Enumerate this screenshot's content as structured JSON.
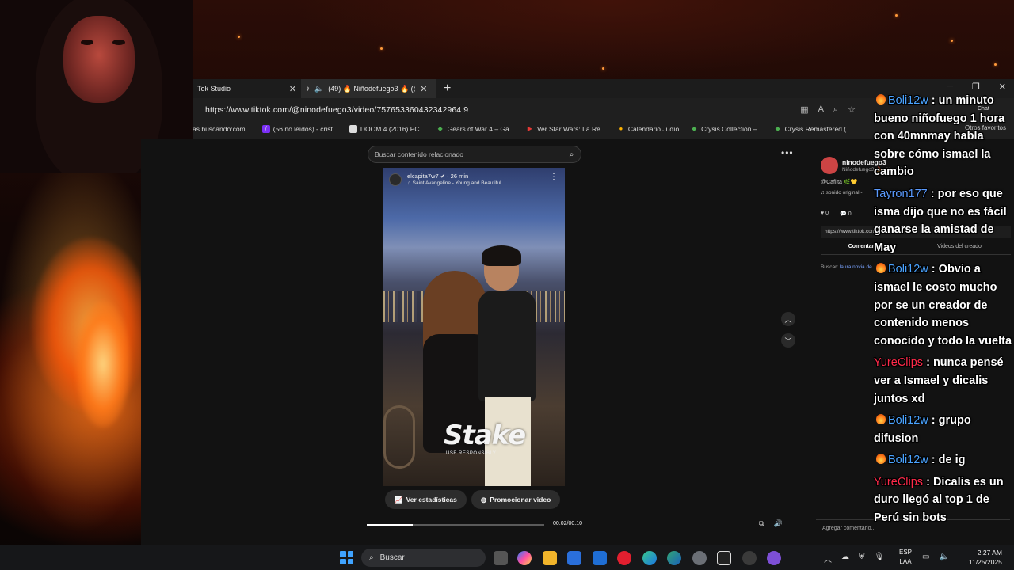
{
  "browser": {
    "tabs": [
      {
        "label": "Tok Studio"
      },
      {
        "label": "(49) 🔥 Niñodefuego3 🔥 (@"
      }
    ],
    "url": "https://www.tiktok.com/@ninodefuego3/video/757653360432342964 9",
    "bookmarks": [
      {
        "label": "as buscando:com...",
        "icon": "page-icon"
      },
      {
        "label": "(56 no leídos) - crist...",
        "icon": "yahoo-icon"
      },
      {
        "label": "DOOM 4 (2016) PC...",
        "icon": "page-icon"
      },
      {
        "label": "Gears of War 4 – Ga...",
        "icon": "gamepad-icon"
      },
      {
        "label": "Ver Star Wars: La Re...",
        "icon": "play-icon"
      },
      {
        "label": "Calendario Judío",
        "icon": "page-icon"
      },
      {
        "label": "Crysis Collection –...",
        "icon": "gamepad-icon"
      },
      {
        "label": "Crysis Remastered (...",
        "icon": "gamepad-icon"
      }
    ],
    "other_favorites": "Otros favoritos"
  },
  "tiktok": {
    "search_placeholder": "Buscar contenido relacionado",
    "video": {
      "user": "elcapita7w7 ✔ · 26 min",
      "song": "♫ Saint Avangeline - Young and Beautiful",
      "watermark": "Stake",
      "watermark_sub": "USE RESPONSIBLY"
    },
    "actions": {
      "stats": "Ver estadísticas",
      "promote": "Promocionar video"
    },
    "progress": 0.26,
    "time": "00:02/00:10",
    "panel": {
      "name": "ninodefuego3",
      "handle": "Niñodefuego3 🔥 · Hace 1 h",
      "desc": "@Cafiita 🌿💛",
      "sound": "♫ sonido original - ",
      "likes": "0",
      "comments": "0",
      "link": "https://www.tiktok.com/...",
      "tab_comments": "Comentarios",
      "tab_creator": "Videos del creador",
      "search_label": "Buscar:",
      "search_term": "laura novia de",
      "comment_placeholder": "Agregar comentario..."
    }
  },
  "chat": {
    "label": "Chat",
    "messages": [
      {
        "user": "Boli12w",
        "color": "#4aa3ff",
        "badge": true,
        "text": "un minuto bueno niñofuego 1 hora con 40mnmay habla sobre cómo ismael la cambio"
      },
      {
        "user": "Tayron177",
        "color": "#5b9bff",
        "badge": false,
        "text": "por eso que isma dijo que no es fácil ganarse la amistad de May"
      },
      {
        "user": "Boli12w",
        "color": "#4aa3ff",
        "badge": true,
        "text": "Obvio a ismael le costo mucho por se un creador de contenido menos conocido y todo la vuelta"
      },
      {
        "user": "YureClips",
        "color": "#ff2a4a",
        "badge": false,
        "text": "nunca pensé ver a Ismael y dicalis juntos xd"
      },
      {
        "user": "Boli12w",
        "color": "#4aa3ff",
        "badge": true,
        "text": "grupo difusion"
      },
      {
        "user": "Boli12w",
        "color": "#4aa3ff",
        "badge": true,
        "text": "de ig"
      },
      {
        "user": "YureClips",
        "color": "#ff2a4a",
        "badge": false,
        "text": "Dicalis es un duro llegó al top 1 de Perú sin bots"
      }
    ]
  },
  "taskbar": {
    "search": "Buscar",
    "lang_top": "ESP",
    "lang_bottom": "LAA",
    "time": "2:27 AM",
    "date": "11/25/2025"
  }
}
